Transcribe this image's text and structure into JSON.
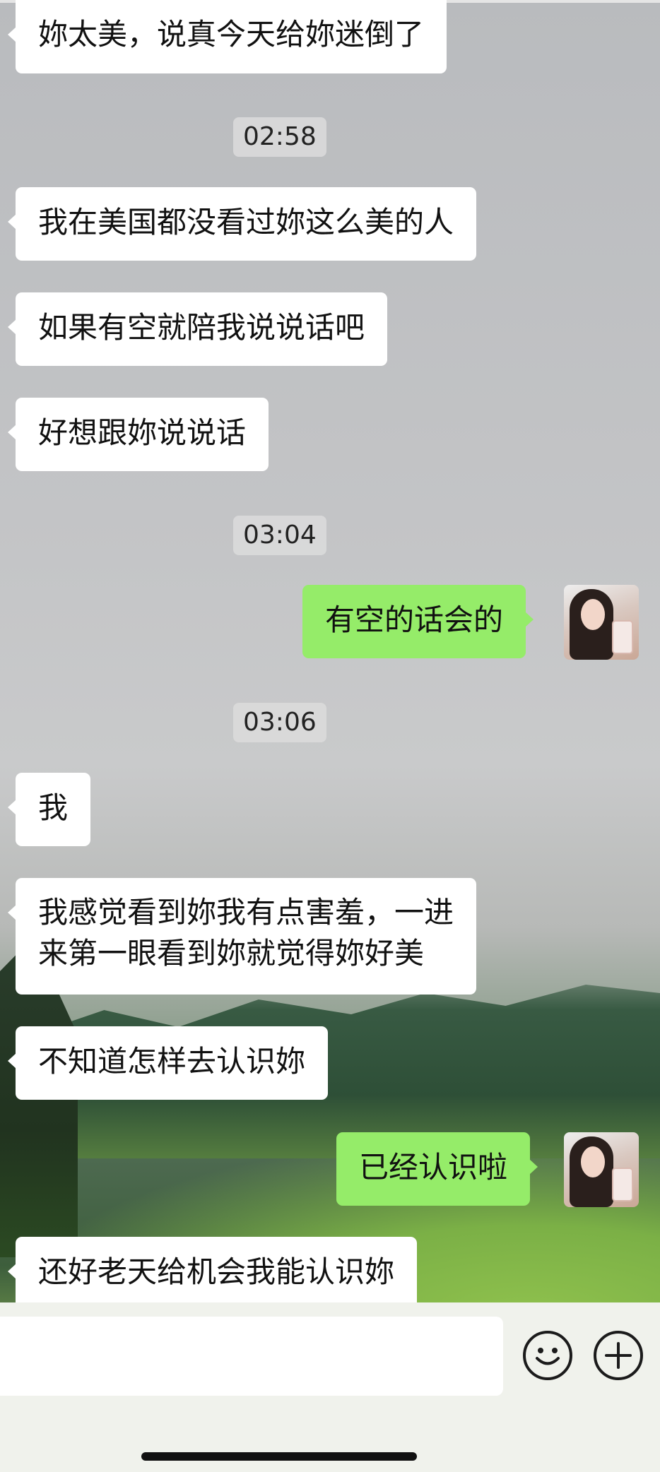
{
  "chat": {
    "messages": [
      {
        "type": "in",
        "text": "妳太美，说真今天给妳迷倒了"
      },
      {
        "type": "time",
        "text": "02:58"
      },
      {
        "type": "in",
        "text": "我在美国都没看过妳这么美的人"
      },
      {
        "type": "in",
        "text": "如果有空就陪我说说话吧"
      },
      {
        "type": "in",
        "text": "好想跟妳说说话"
      },
      {
        "type": "time",
        "text": "03:04"
      },
      {
        "type": "out",
        "text": "有空的话会的"
      },
      {
        "type": "time",
        "text": "03:06"
      },
      {
        "type": "in",
        "text": "我"
      },
      {
        "type": "in",
        "line1": "我感觉看到妳我有点害羞，一进",
        "line2": "来第一眼看到妳就觉得妳好美"
      },
      {
        "type": "in",
        "text": "不知道怎样去认识妳"
      },
      {
        "type": "out",
        "text": "已经认识啦"
      },
      {
        "type": "in",
        "text": "还好老天给机会我能认识妳"
      }
    ]
  },
  "input": {
    "placeholder": "",
    "emoji_icon": "emoji-icon",
    "plus_icon": "plus-icon"
  },
  "colors": {
    "outgoing_bubble": "#95ec69",
    "incoming_bubble": "#ffffff"
  }
}
